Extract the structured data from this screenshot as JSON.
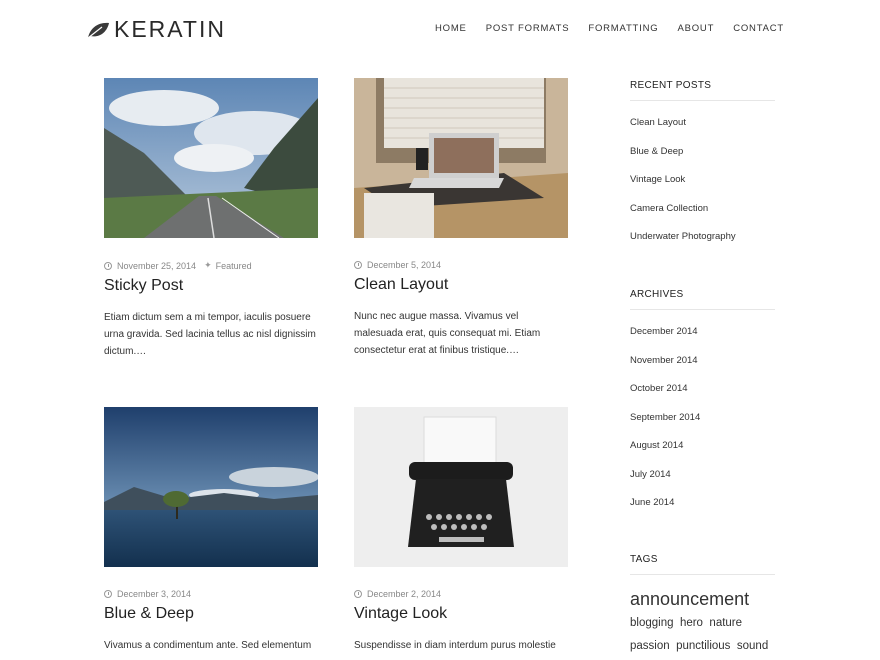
{
  "site": {
    "title": "KERATIN"
  },
  "nav": [
    "HOME",
    "POST FORMATS",
    "FORMATTING",
    "ABOUT",
    "CONTACT"
  ],
  "posts": [
    {
      "date": "November 25, 2014",
      "tag": "Featured",
      "title": "Sticky Post",
      "excerpt": "Etiam dictum sem a mi tempor, iaculis posuere urna gravida. Sed lacinia tellus ac nisl dignissim dictum.…"
    },
    {
      "date": "December 5, 2014",
      "title": "Clean Layout",
      "excerpt": "Nunc nec augue massa. Vivamus vel malesuada erat, quis consequat mi. Etiam consectetur erat at finibus tristique.…"
    },
    {
      "date": "December 3, 2014",
      "title": "Blue & Deep",
      "excerpt": "Vivamus a condimentum ante. Sed elementum"
    },
    {
      "date": "December 2, 2014",
      "title": "Vintage Look",
      "excerpt": "Suspendisse in diam interdum purus molestie"
    }
  ],
  "sidebar": {
    "recent_title": "RECENT POSTS",
    "recent": [
      "Clean Layout",
      "Blue & Deep",
      "Vintage Look",
      "Camera Collection",
      "Underwater Photography"
    ],
    "archives_title": "ARCHIVES",
    "archives": [
      "December 2014",
      "November 2014",
      "October 2014",
      "September 2014",
      "August 2014",
      "July 2014",
      "June 2014"
    ],
    "tags_title": "TAGS",
    "tags": [
      "announcement",
      "blogging",
      "hero",
      "nature",
      "passion",
      "punctilious",
      "sound"
    ]
  }
}
